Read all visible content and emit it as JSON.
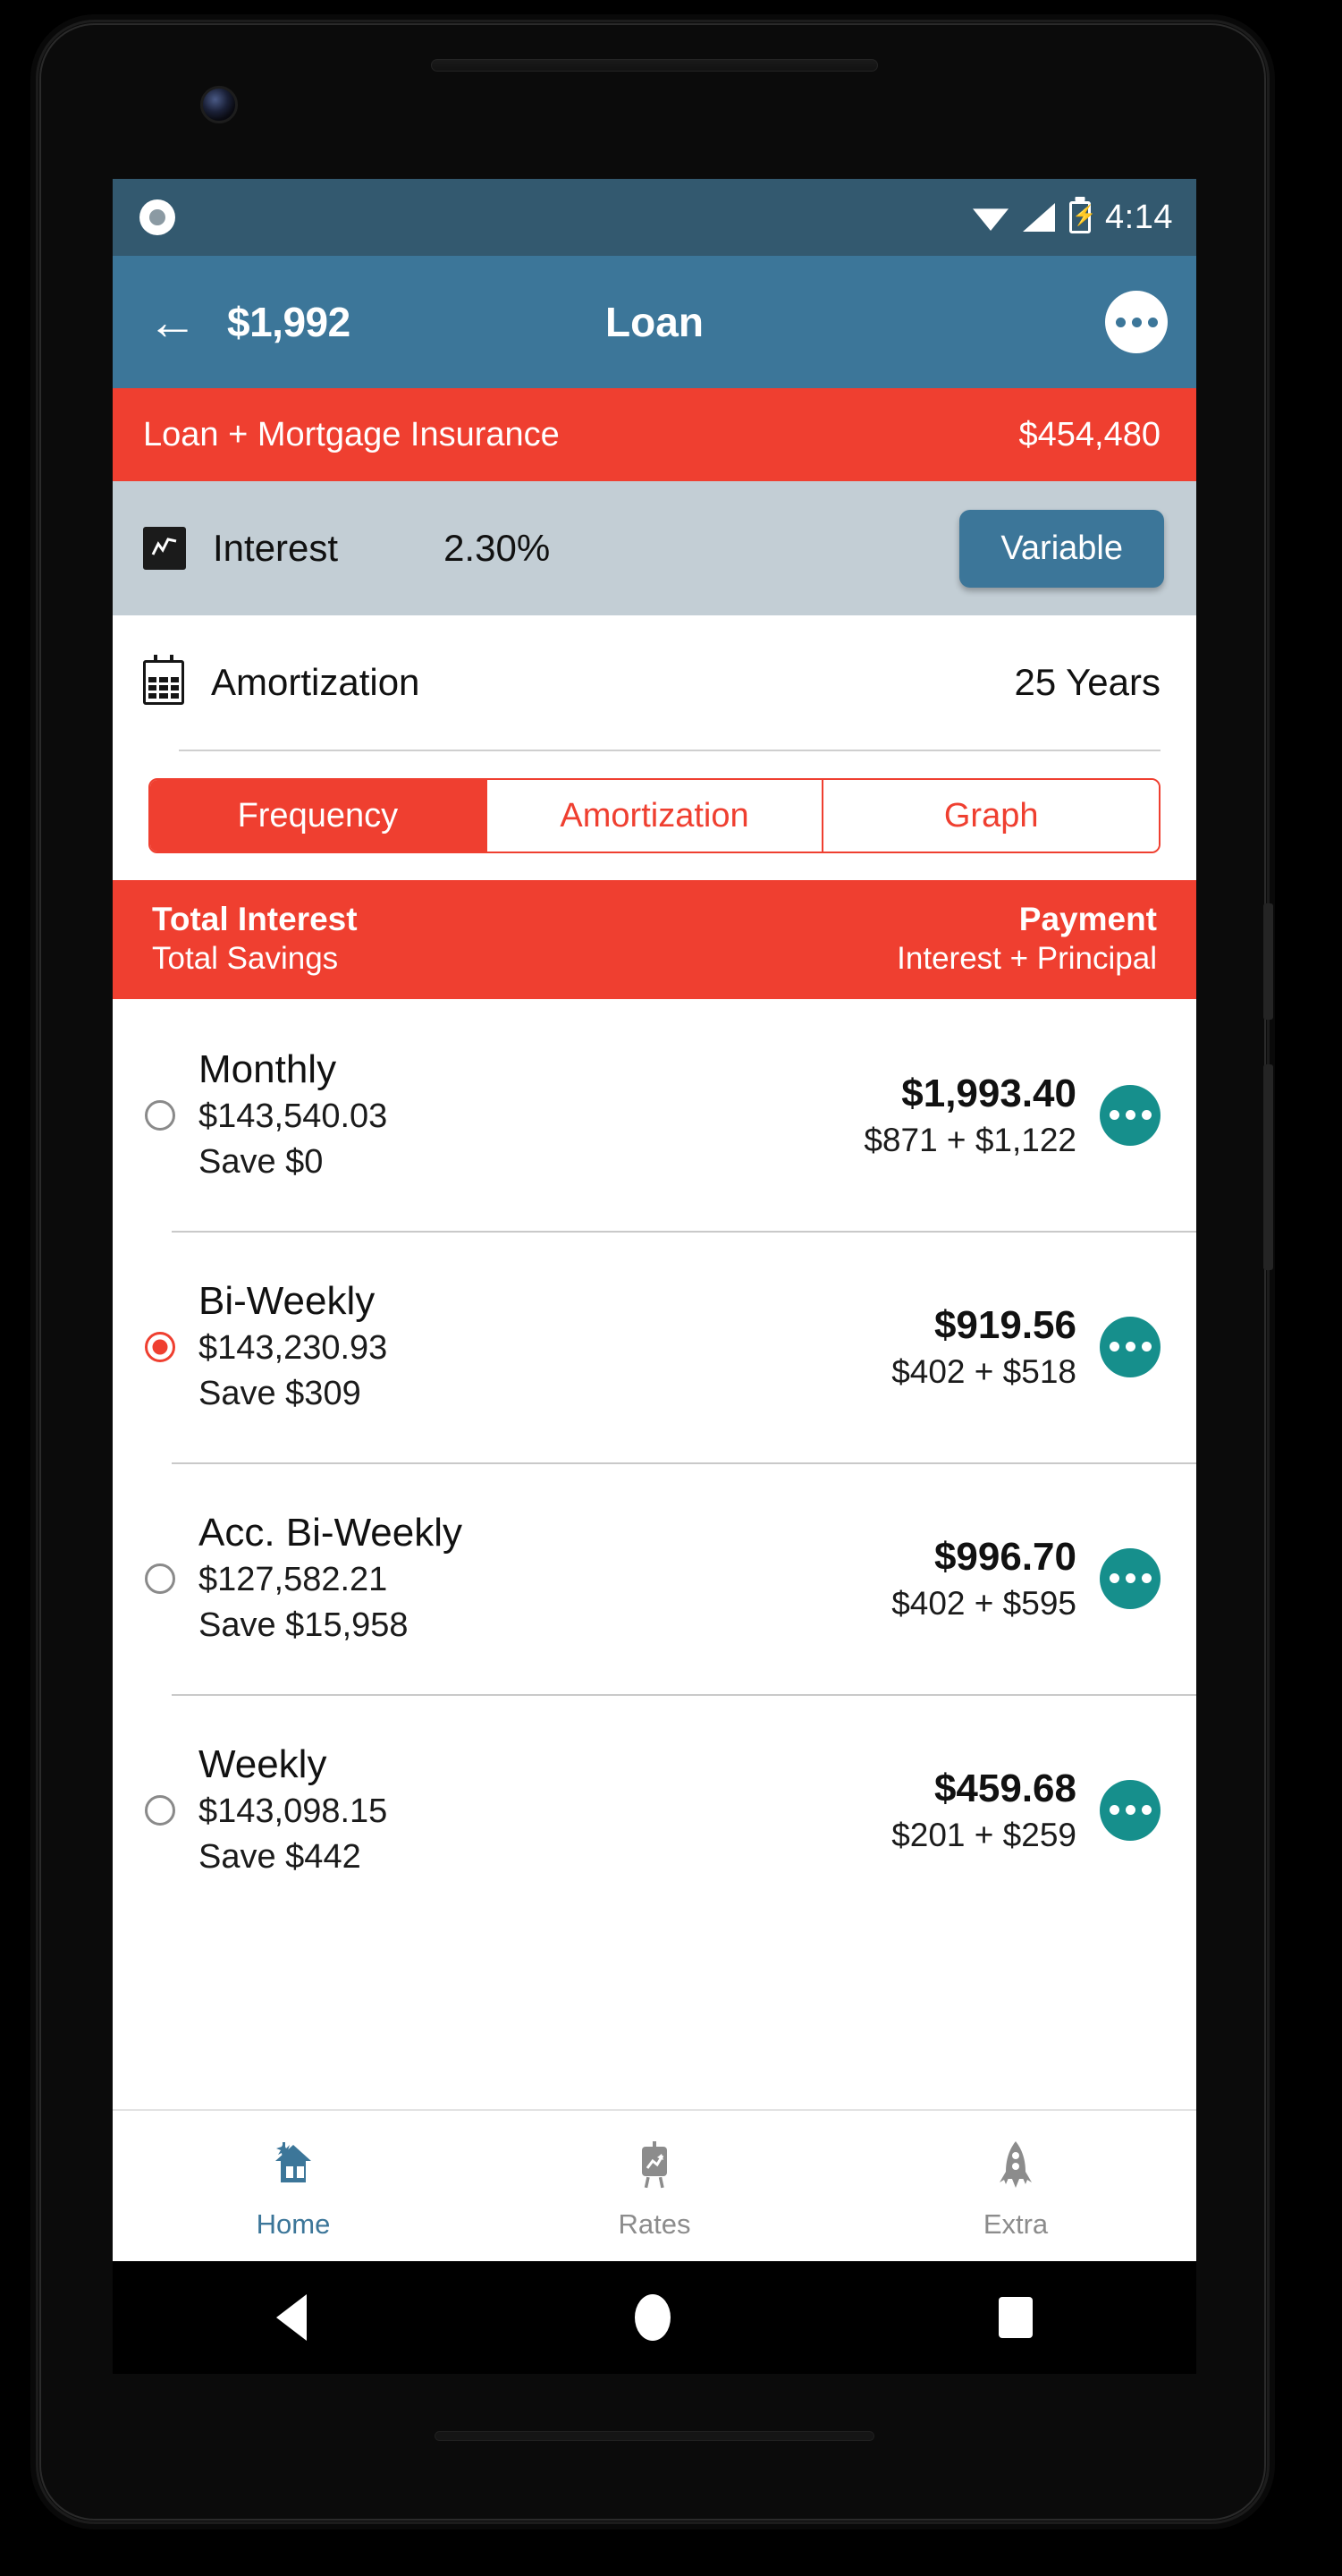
{
  "status_bar": {
    "notification_icon": "circle-notification-icon",
    "wifi_icon": "wifi-icon",
    "signal_icon": "cell-signal-icon",
    "battery_icon": "battery-charging-icon",
    "time": "4:14"
  },
  "app_bar": {
    "back_icon": "back-arrow-icon",
    "amount": "$1,992",
    "title": "Loan",
    "overflow_icon": "overflow-menu-icon"
  },
  "summary": {
    "label": "Loan + Mortgage Insurance",
    "value": "$454,480"
  },
  "interest": {
    "icon": "line-chart-icon",
    "label": "Interest",
    "rate": "2.30%",
    "type_button": "Variable"
  },
  "amortization": {
    "icon": "calendar-icon",
    "label": "Amortization",
    "value": "25 Years"
  },
  "tabs": [
    {
      "label": "Frequency",
      "active": true
    },
    {
      "label": "Amortization",
      "active": false
    },
    {
      "label": "Graph",
      "active": false
    }
  ],
  "table_header": {
    "left_primary": "Total Interest",
    "left_secondary": "Total Savings",
    "right_primary": "Payment",
    "right_secondary": "Interest + Principal"
  },
  "frequency_rows": [
    {
      "name": "Monthly",
      "total_interest": "$143,540.03",
      "savings": "Save $0",
      "payment": "$1,993.40",
      "split": "$871 + $1,122",
      "selected": false,
      "more_icon": "more-options-icon"
    },
    {
      "name": "Bi-Weekly",
      "total_interest": "$143,230.93",
      "savings": "Save $309",
      "payment": "$919.56",
      "split": "$402 + $518",
      "selected": true,
      "more_icon": "more-options-icon"
    },
    {
      "name": "Acc. Bi-Weekly",
      "total_interest": "$127,582.21",
      "savings": "Save $15,958",
      "payment": "$996.70",
      "split": "$402 + $595",
      "selected": false,
      "more_icon": "more-options-icon"
    },
    {
      "name": "Weekly",
      "total_interest": "$143,098.15",
      "savings": "Save $442",
      "payment": "$459.68",
      "split": "$201 + $259",
      "selected": false,
      "more_icon": "more-options-icon"
    }
  ],
  "bottom_nav": [
    {
      "label": "Home",
      "icon": "house-icon",
      "active": true
    },
    {
      "label": "Rates",
      "icon": "chart-easel-icon",
      "active": false
    },
    {
      "label": "Extra",
      "icon": "rocket-icon",
      "active": false
    }
  ],
  "android_nav": {
    "back_icon": "android-back-icon",
    "home_icon": "android-home-icon",
    "recents_icon": "android-recents-icon"
  },
  "colors": {
    "status_bar": "#33596f",
    "app_bar": "#3c7699",
    "accent_red": "#ef3f30",
    "interest_row": "#c3ced5",
    "teal": "#168f8c",
    "nav_active": "#3c7699"
  }
}
